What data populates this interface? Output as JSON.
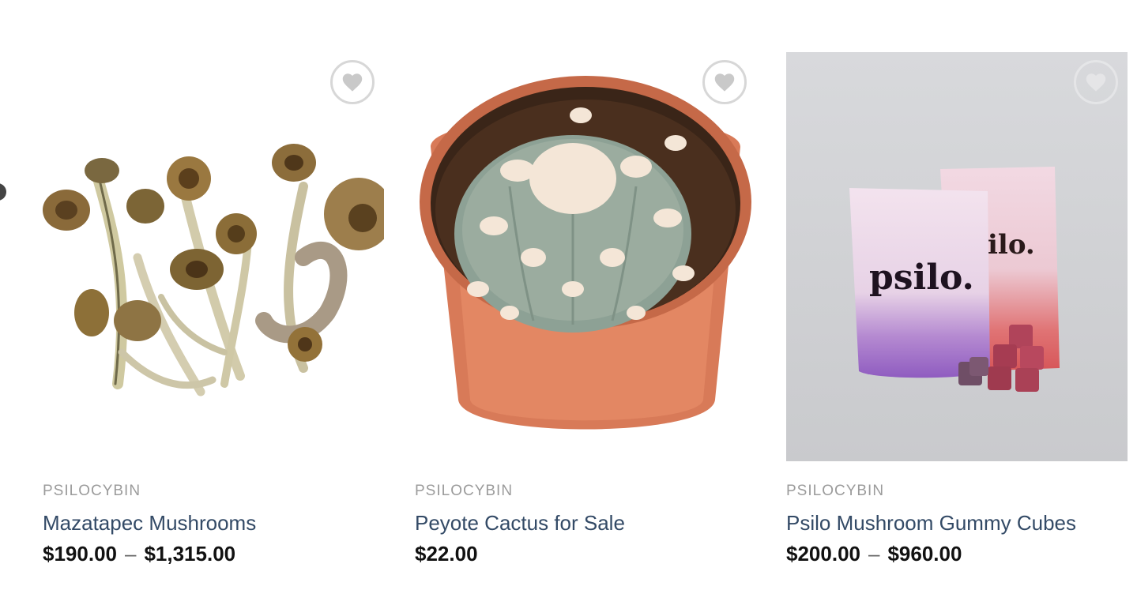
{
  "products": [
    {
      "category": "PSILOCYBIN",
      "title": "Mazatapec Mushrooms",
      "price_low": "$190.00",
      "price_sep": "–",
      "price_high": "$1,315.00",
      "image_icon": "dried-mushrooms-image"
    },
    {
      "category": "PSILOCYBIN",
      "title": "Peyote Cactus for Sale",
      "price_low": "$22.00",
      "price_sep": "",
      "price_high": "",
      "image_icon": "potted-cactus-image"
    },
    {
      "category": "PSILOCYBIN",
      "title": "Psilo Mushroom Gummy Cubes",
      "price_low": "$200.00",
      "price_sep": "–",
      "price_high": "$960.00",
      "image_icon": "gummy-pouches-image",
      "image_text_front": "psilo.",
      "image_text_back": "ilo."
    }
  ],
  "wishlist_icon": "heart-icon",
  "colors": {
    "title": "#334a66",
    "category": "#9b9b9b",
    "price": "#111111"
  }
}
